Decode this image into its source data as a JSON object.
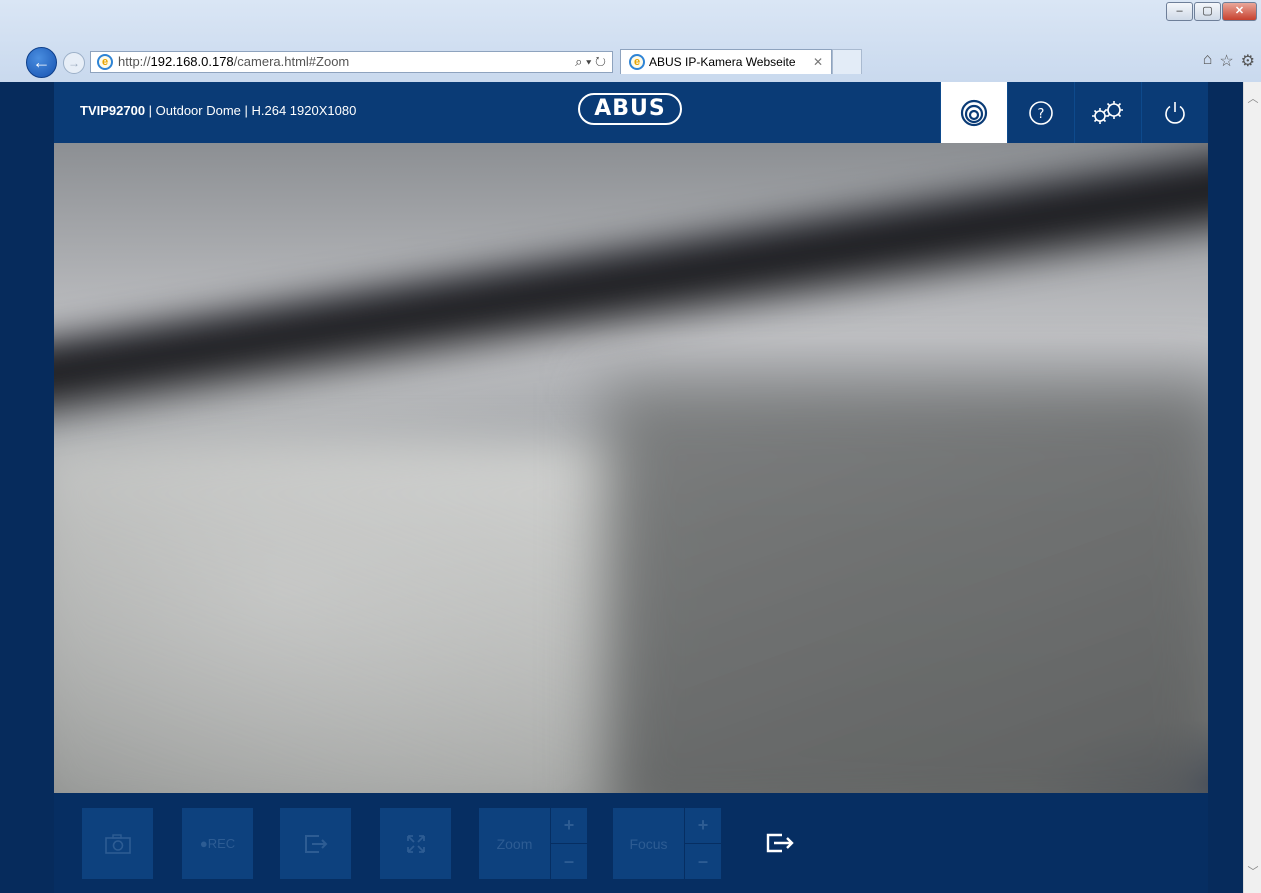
{
  "window": {
    "minimize_label": "–",
    "maximize_label": "▢",
    "close_label": "✕"
  },
  "browser": {
    "back_glyph": "←",
    "forward_glyph": "→",
    "url_prefix": "http://",
    "url_host": "192.168.0.178",
    "url_path": "/camera.html#Zoom",
    "address_tools": "⌕ ▾ ↻",
    "tab_title": "ABUS IP-Kamera Webseite",
    "tab_close": "✕",
    "icons": [
      "home-icon",
      "star-icon",
      "gear-icon"
    ],
    "home_glyph": "⌂",
    "star_glyph": "☆",
    "gear_glyph": "⚙"
  },
  "header": {
    "model": "TVIP92700",
    "details": " | Outdoor Dome | H.264 1920X1080",
    "logo_text": "ABUS",
    "nav": [
      {
        "icon": "live-view-icon",
        "active": true
      },
      {
        "icon": "help-icon",
        "active": false
      },
      {
        "icon": "settings-icon",
        "active": false
      },
      {
        "icon": "power-icon",
        "active": false
      }
    ]
  },
  "controls": {
    "rec_label": "●REC",
    "zoom_label": "Zoom",
    "focus_label": "Focus",
    "plus": "+",
    "minus": "–"
  },
  "scrollbar": {
    "up": "︿",
    "down": "﹀"
  },
  "colors": {
    "header_bg": "#0a3b76",
    "page_bg": "#062e62",
    "button_bg": "#0d417e",
    "button_text_disabled": "#2d5c93",
    "accent": "#ffffff"
  }
}
